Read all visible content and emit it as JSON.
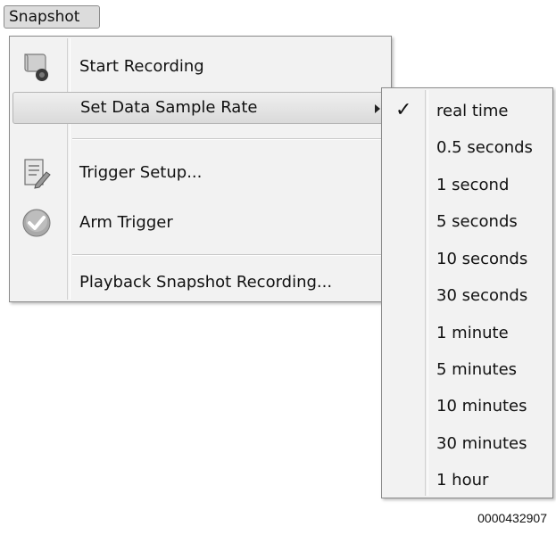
{
  "menubar": {
    "snapshot_label": "Snapshot"
  },
  "menu": {
    "items": [
      {
        "label": "Start Recording",
        "icon": "record-camera-icon"
      },
      {
        "label": "Set Data Sample Rate",
        "has_submenu": true,
        "highlighted": true
      },
      {
        "label": "Trigger Setup...",
        "icon": "notepad-pencil-icon"
      },
      {
        "label": "Arm Trigger",
        "icon": "check-circle-icon"
      },
      {
        "label": "Playback Snapshot Recording..."
      }
    ]
  },
  "submenu": {
    "selected": "real time",
    "check_glyph": "✓",
    "items": [
      "real time",
      "0.5 seconds",
      "1 second",
      "5 seconds",
      "10 seconds",
      "30 seconds",
      "1 minute",
      "5 minutes",
      "10 minutes",
      "30 minutes",
      "1 hour"
    ]
  },
  "caption": "0000432907"
}
